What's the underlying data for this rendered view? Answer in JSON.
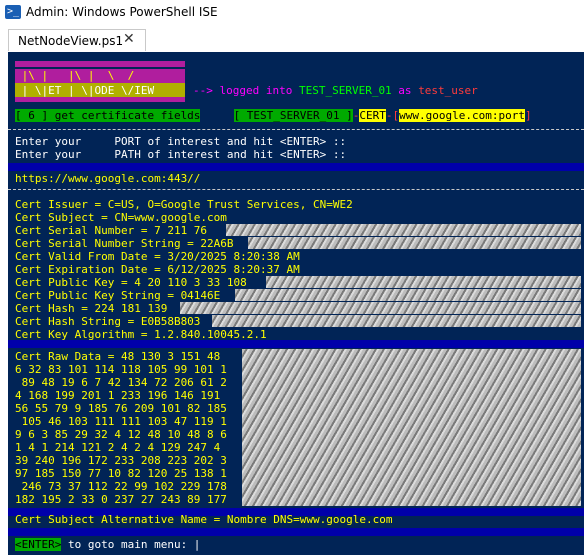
{
  "window": {
    "title": "Admin: Windows PowerShell ISE",
    "icon": "powershell-icon"
  },
  "tab": {
    "label": "NetNodeView.ps1",
    "close": "✕"
  },
  "banner": {
    "dash1": "-------------",
    "line1": " |\\ |   |\\ |  \\  /",
    "line2": " | \\|ET | \\|ODE \\/IEW",
    "logged_prefix": "--> logged into ",
    "server": "TEST_SERVER_01",
    "as": " as ",
    "user": "test_user"
  },
  "menu": {
    "option": "[ 6 ] get certificate fields",
    "status_server": "[ TEST_SERVER_01 ]",
    "status_sep": "-",
    "status_cert": "CERT",
    "status_dash": "-[",
    "status_host": "www.google.com",
    "status_colon": ":",
    "status_port": "port",
    "status_end": "]"
  },
  "prompts": {
    "port": "Enter your     PORT of interest and hit <ENTER> ::",
    "path": "Enter your     PATH of interest and hit <ENTER> ::"
  },
  "url": "https://www.google.com:443//",
  "cert": {
    "issuer": "Cert Issuer = C=US, O=Google Trust Services, CN=WE2",
    "subject": "Cert Subject = CN=www.google.com",
    "serial": "Cert Serial Number = 7 211 76",
    "serial_string": "Cert Serial Number String = 22A6B",
    "valid_from": "Cert Valid From Date = 3/20/2025 8:20:38 AM",
    "expiration": "Cert Expiration Date = 6/12/2025 8:20:37 AM",
    "public_key": "Cert Public Key = 4 20 110 3 33 108",
    "public_key_string": "Cert Public Key String = 04146E",
    "hash": "Cert Hash = 224 181 139",
    "hash_string": "Cert Hash String = E0B58B803",
    "key_algorithm": "Cert Key Algorithm = 1.2.840.10045.2.1"
  },
  "raw": [
    "Cert Raw Data = 48 130 3 151 48",
    "6 32 83 101 114 118 105 99 101 1",
    " 89 48 19 6 7 42 134 72 206 61 2",
    "4 168 199 201 1 233 196 146 191",
    "56 55 79 9 185 76 209 101 82 185",
    " 105 46 103 111 111 103 47 119 1",
    "9 6 3 85 29 32 4 12 48 10 48 8 6",
    "1 4 1 214 121 2 4 2 4 129 247 4",
    "39 240 196 172 233 208 223 202 3",
    "97 185 150 77 10 82 120 25 138 1",
    " 246 73 37 112 22 99 102 229 178",
    "182 195 2 33 0 237 27 243 89 177"
  ],
  "san": "Cert Subject Alternative Name = Nombre DNS=www.google.com",
  "footer": {
    "key": "<ENTER>",
    "text": " to goto main menu: |"
  },
  "colors": {
    "console_bg": "#012456",
    "text_yellow": "#ffff00",
    "text_magenta": "#ff00ff",
    "band_blue": "#0000aa"
  }
}
